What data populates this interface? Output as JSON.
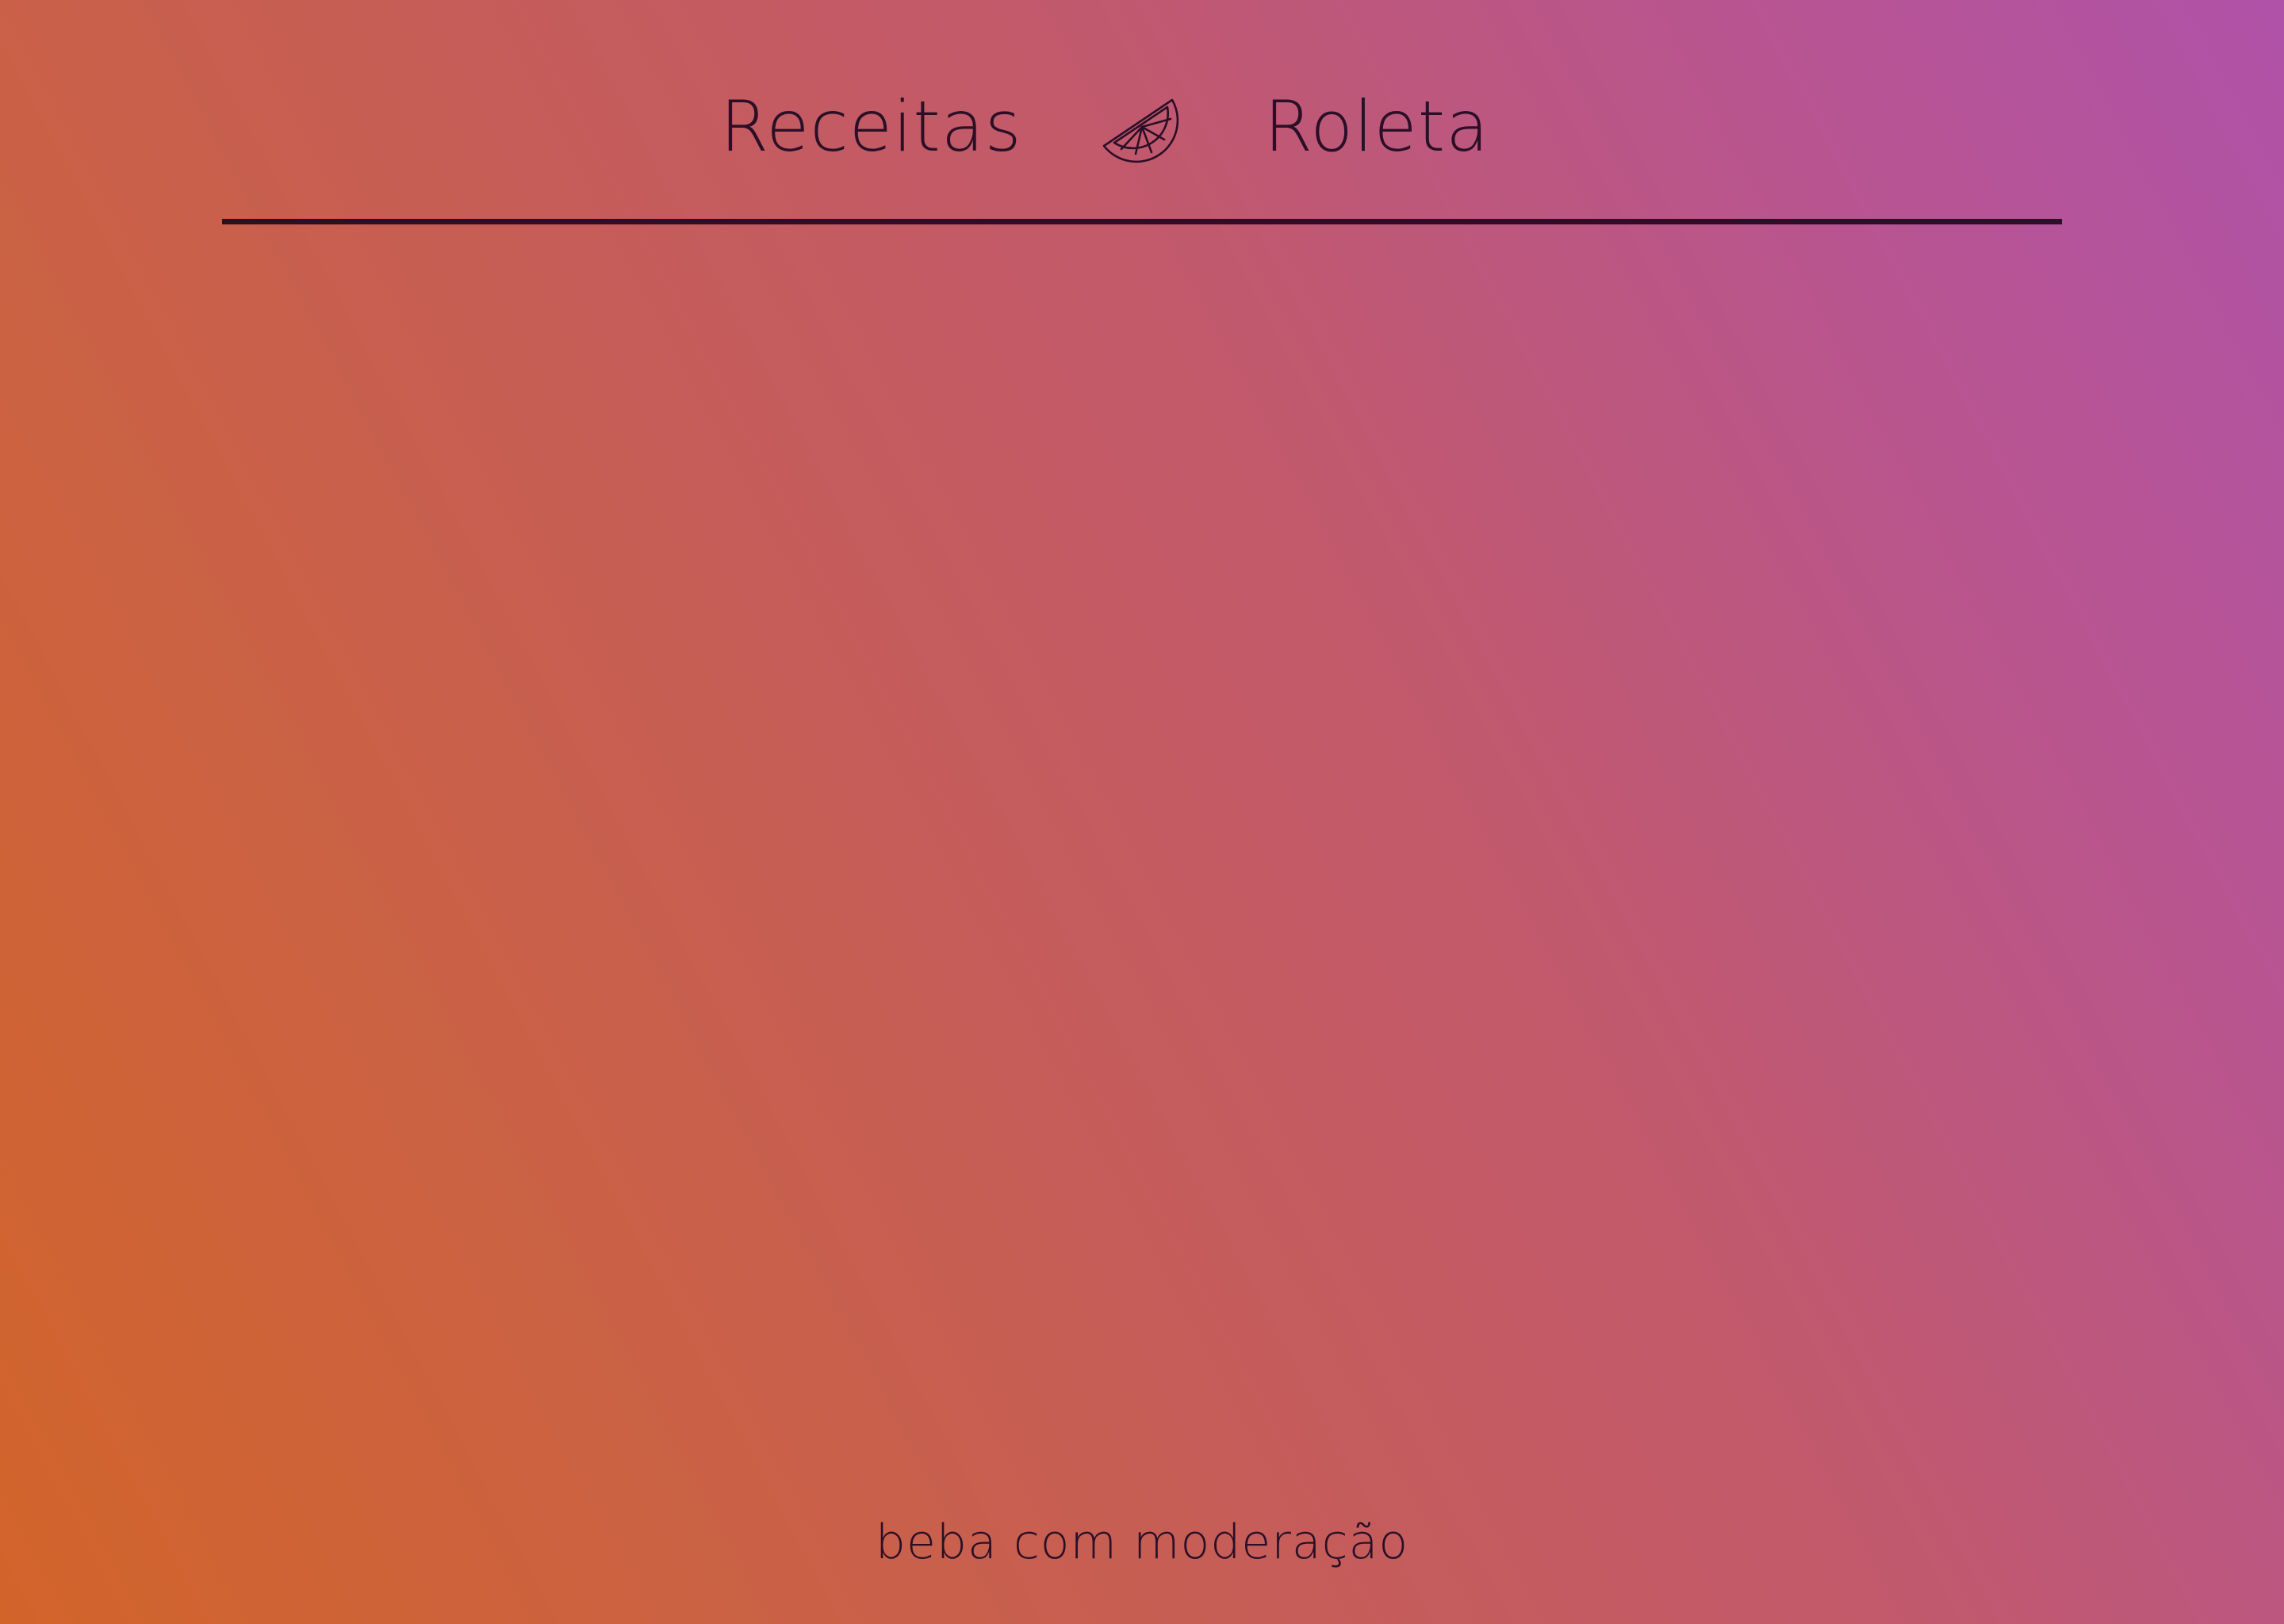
{
  "nav": {
    "recipes_label": "Receitas",
    "roulette_label": "Roleta",
    "logo_icon": "lime-slice-icon"
  },
  "footer": {
    "text": "beba com moderação"
  },
  "colors": {
    "text": "#2a0f27",
    "gradient_start": "#d2642a",
    "gradient_end": "#b052a8"
  }
}
